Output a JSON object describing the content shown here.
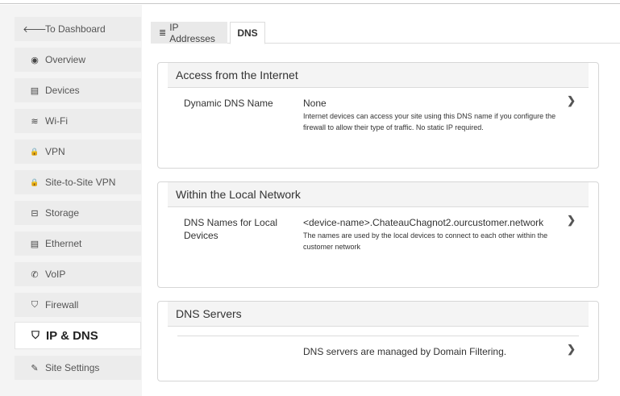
{
  "sidebar": {
    "items": [
      {
        "label": "To Dashboard",
        "icon": "arrow-left-icon",
        "glyph": "🡐"
      },
      {
        "label": "Overview",
        "icon": "eye-icon",
        "glyph": "◉"
      },
      {
        "label": "Devices",
        "icon": "devices-icon",
        "glyph": "▤"
      },
      {
        "label": "Wi-Fi",
        "icon": "wifi-icon",
        "glyph": "≋"
      },
      {
        "label": "VPN",
        "icon": "lock-icon",
        "glyph": "🔒"
      },
      {
        "label": "Site-to-Site VPN",
        "icon": "lock-icon",
        "glyph": "🔒"
      },
      {
        "label": "Storage",
        "icon": "storage-icon",
        "glyph": "⊟"
      },
      {
        "label": "Ethernet",
        "icon": "ethernet-icon",
        "glyph": "▤"
      },
      {
        "label": "VoIP",
        "icon": "phone-icon",
        "glyph": "✆"
      },
      {
        "label": "Firewall",
        "icon": "shield-icon",
        "glyph": "⛉"
      },
      {
        "label": "IP & DNS",
        "icon": "shield-icon",
        "glyph": "⛉",
        "active": true
      },
      {
        "label": "Site Settings",
        "icon": "edit-icon",
        "glyph": "✎"
      }
    ]
  },
  "tabs": {
    "ip_addresses": {
      "label": "IP Addresses",
      "glyph": "≣"
    },
    "dns": {
      "label": "DNS"
    }
  },
  "sections": {
    "internet": {
      "title": "Access from the Internet",
      "label": "Dynamic DNS Name",
      "value": "None",
      "description": "Internet devices can access your site using this DNS name if you configure the firewall to allow their type of traffic. No static IP required."
    },
    "local": {
      "title": "Within the Local Network",
      "label": "DNS Names for Local Devices",
      "value": "<device-name>.ChateauChagnot2.ourcustomer.network",
      "description": "The names are used by the local devices to connect to each other within the customer network"
    },
    "servers": {
      "title": "DNS Servers",
      "value": "DNS servers are managed by Domain Filtering."
    }
  },
  "chevron_glyph": "❯"
}
